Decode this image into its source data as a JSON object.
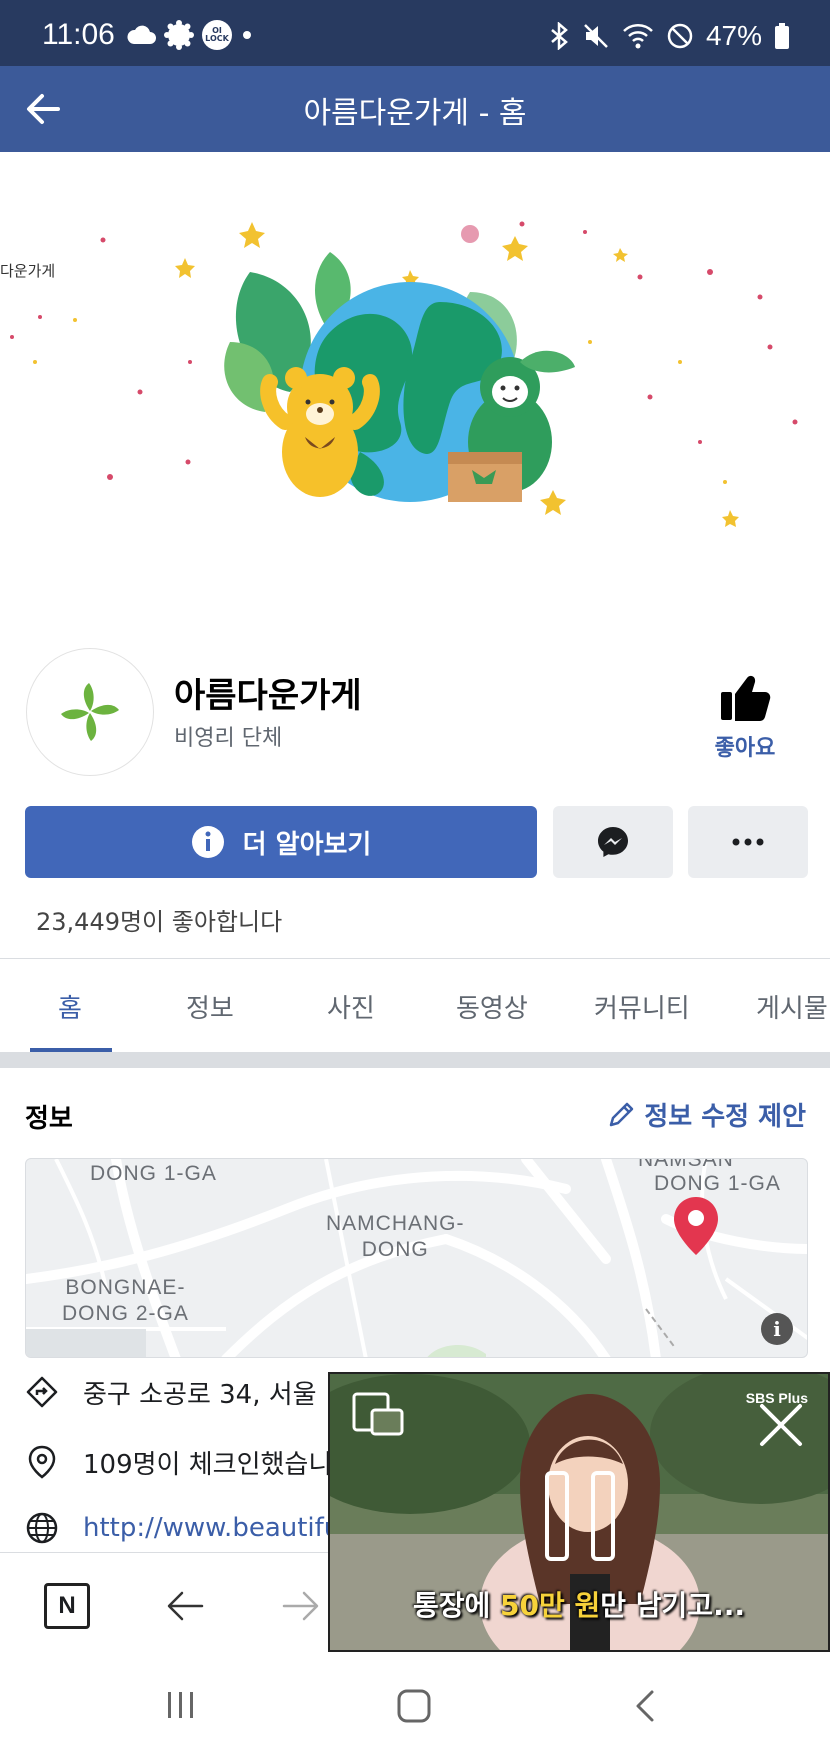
{
  "status_bar": {
    "time": "11:06",
    "ol_lock": "OI LOCK",
    "battery": "47%"
  },
  "header": {
    "title": "아름다운가게 - 홈"
  },
  "cover": {
    "watermark": "다운가게"
  },
  "profile": {
    "name": "아름다운가게",
    "category": "비영리 단체",
    "like_label": "좋아요"
  },
  "actions": {
    "learn_more": "더 알아보기"
  },
  "likes_count": "23,449명이 좋아합니다",
  "tabs": [
    {
      "label": "홈",
      "active": true
    },
    {
      "label": "정보"
    },
    {
      "label": "사진"
    },
    {
      "label": "동영상"
    },
    {
      "label": "커뮤니티"
    },
    {
      "label": "게시물"
    }
  ],
  "info": {
    "title": "정보",
    "suggest_edit": "정보 수정 제안",
    "map_labels": {
      "top_left": "DONG 1-GA",
      "center": "NAMCHANG-\nDONG",
      "bottom_left": "BONGNAE-\nDONG 2-GA",
      "top_right_cut": "NAMSAN",
      "top_right": "DONG 1-GA"
    },
    "address": "중구 소공로 34, 서울",
    "checkins": "109명이 체크인했습니",
    "website": "http://www.beautifu"
  },
  "video": {
    "caption_pre": "통장에 ",
    "caption_highlight": "50만 원",
    "caption_post": "만 남기고...",
    "brand": "SBS Plus"
  },
  "browser": {
    "n_label": "N"
  },
  "colors": {
    "status_bar": "#283a60",
    "header": "#3c5a99",
    "accent": "#3b5ea8",
    "primary_button": "#4167b9"
  }
}
